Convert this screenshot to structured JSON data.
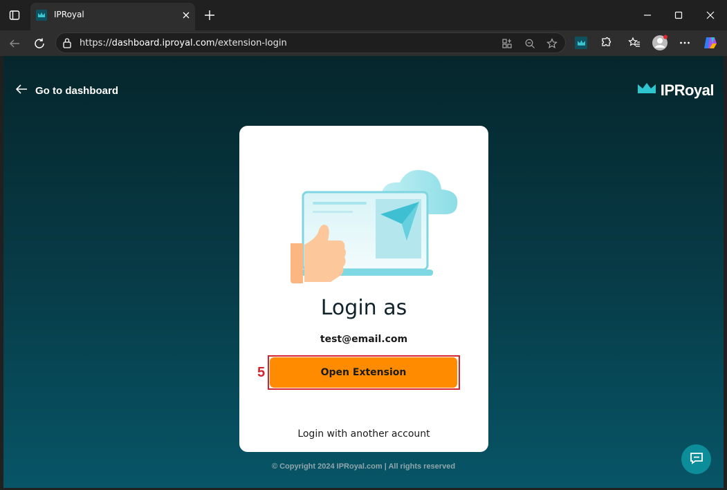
{
  "browser": {
    "tab_title": "IPRoyal",
    "url_prefix": "https://",
    "url_host": "dashboard.iproyal.com",
    "url_path": "/extension-login"
  },
  "page": {
    "back_link": "Go to dashboard",
    "brand": "IPRoyal",
    "card": {
      "title": "Login as",
      "email": "test@email.com",
      "open_button": "Open Extension",
      "step_number": "5",
      "alt_login": "Login with another account"
    },
    "copyright": "© Copyright 2024 IPRoyal.com | All rights reserved"
  },
  "colors": {
    "accent": "#ff8c00",
    "highlight": "#d3232f",
    "page_bg_top": "#06262c",
    "page_bg_bottom": "#075567",
    "chat": "#0d8c99"
  },
  "icons": [
    "sidebar-toggle-icon",
    "crown-icon",
    "close-icon",
    "plus-icon",
    "minimize-icon",
    "maximize-icon",
    "back-arrow-icon",
    "forward-arrow-icon",
    "refresh-icon",
    "lock-icon",
    "apps-icon",
    "zoom-icon",
    "star-icon",
    "extensions-icon",
    "favorites-icon",
    "profile-icon",
    "more-icon",
    "copilot-icon",
    "arrow-left-icon",
    "chat-icon"
  ]
}
